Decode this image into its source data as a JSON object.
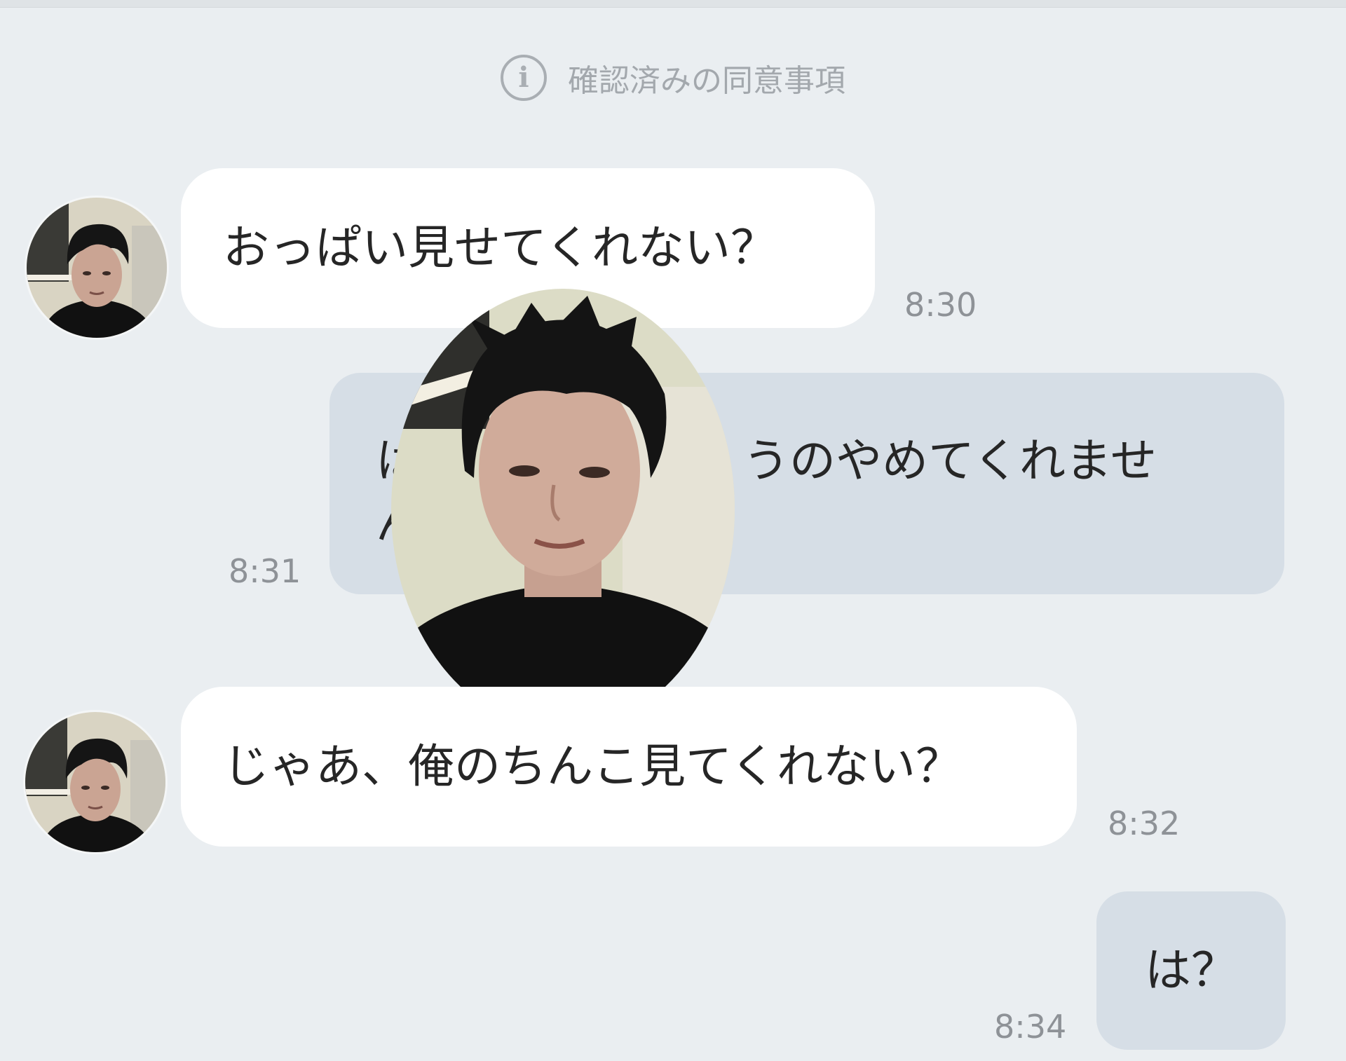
{
  "notice": {
    "icon": "info-icon",
    "text": "確認済みの同意事項"
  },
  "messages": [
    {
      "side": "incoming",
      "text": "おっぱい見せてくれない？",
      "time": "8:30"
    },
    {
      "side": "outgoing",
      "line1_left": "はい",
      "line1_right": "うのやめてくれませ",
      "line2": "んか",
      "time": "8:31"
    },
    {
      "side": "incoming",
      "text": "じゃあ、俺のちんこ見てくれない？",
      "time": "8:32"
    },
    {
      "side": "outgoing",
      "text": "は？",
      "time": "8:34"
    }
  ],
  "colors": {
    "background": "#eaeef1",
    "incoming_bubble": "#ffffff",
    "outgoing_bubble": "#d6dee6",
    "timestamp": "#8e9297"
  }
}
